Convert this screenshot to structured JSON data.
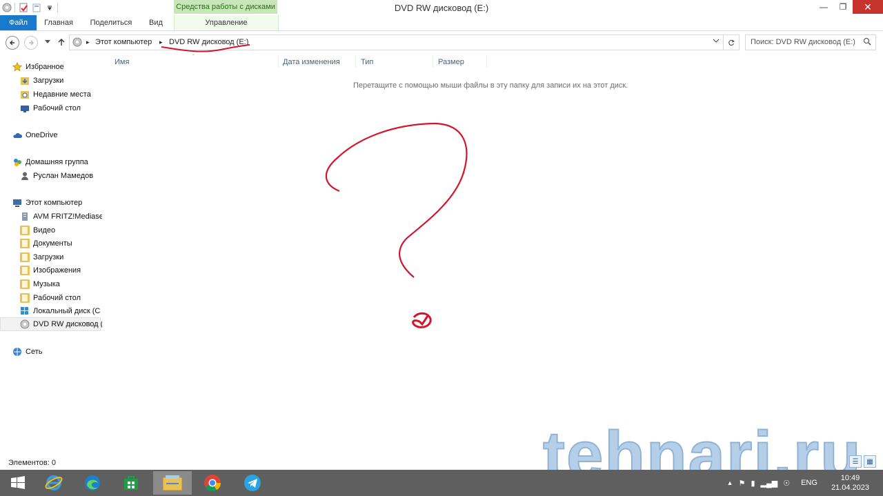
{
  "window": {
    "title": "DVD RW дисковод (E:)",
    "context_group": "Средства работы с дисками"
  },
  "ribbon": {
    "tabs": [
      "Файл",
      "Главная",
      "Поделиться",
      "Вид",
      "Управление"
    ]
  },
  "address": {
    "segments": [
      "Этот компьютер",
      "DVD RW дисковод (E:)"
    ]
  },
  "search": {
    "placeholder": "Поиск: DVD RW дисковод (E:)"
  },
  "sidebar": {
    "groups": [
      {
        "label": "Избранное",
        "icon": "star-icon",
        "items": [
          {
            "label": "Загрузки",
            "icon": "downloads-icon"
          },
          {
            "label": "Недавние места",
            "icon": "recent-icon"
          },
          {
            "label": "Рабочий стол",
            "icon": "desktop-icon"
          }
        ]
      },
      {
        "label": "OneDrive",
        "icon": "onedrive-icon",
        "items": []
      },
      {
        "label": "Домашняя группа",
        "icon": "homegroup-icon",
        "items": [
          {
            "label": "Руслан Мамедов",
            "icon": "user-icon"
          }
        ]
      },
      {
        "label": "Этот компьютер",
        "icon": "computer-icon",
        "items": [
          {
            "label": "AVM FRITZ!Mediase",
            "icon": "media-server-icon"
          },
          {
            "label": "Видео",
            "icon": "folder-icon"
          },
          {
            "label": "Документы",
            "icon": "folder-icon"
          },
          {
            "label": "Загрузки",
            "icon": "folder-icon"
          },
          {
            "label": "Изображения",
            "icon": "folder-icon"
          },
          {
            "label": "Музыка",
            "icon": "folder-icon"
          },
          {
            "label": "Рабочий стол",
            "icon": "folder-icon"
          },
          {
            "label": "Локальный диск (C",
            "icon": "local-disk-icon"
          },
          {
            "label": "DVD RW дисковод (",
            "icon": "dvd-icon",
            "selected": true
          }
        ]
      },
      {
        "label": "Сеть",
        "icon": "network-icon",
        "items": []
      }
    ]
  },
  "columns": [
    "Имя",
    "Дата изменения",
    "Тип",
    "Размер"
  ],
  "empty_message": "Перетащите с помощью мыши файлы в эту папку для записи их на этот диск.",
  "status": {
    "items_label": "Элементов: 0"
  },
  "watermark": "tehnari.ru",
  "taskbar": {
    "apps": [
      "start-icon",
      "ie-icon",
      "edge-icon",
      "store-icon",
      "explorer-icon",
      "chrome-icon",
      "telegram-icon"
    ],
    "language": "ENG",
    "time": "10:49",
    "date": "21.04.2023"
  },
  "colors": {
    "accent": "#1979ca",
    "context_tab": "#c8e7b8",
    "close": "#c7332d",
    "scribble": "#d3142a",
    "taskbar": "#5f5f5f"
  }
}
